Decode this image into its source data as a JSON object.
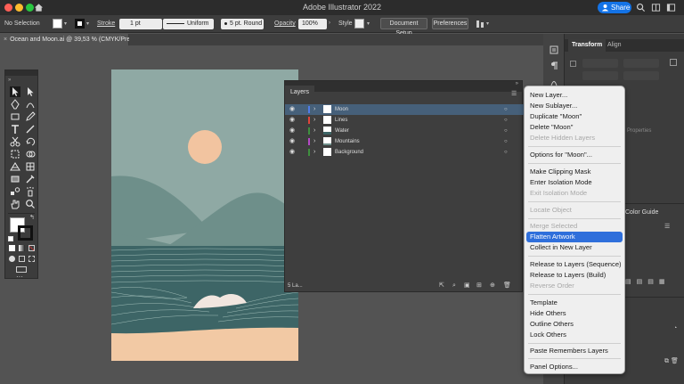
{
  "window": {
    "title": "Adobe Illustrator 2022",
    "share_label": "Share"
  },
  "control_bar": {
    "selection_label": "No Selection",
    "stroke_label": "Stroke",
    "stroke_weight": "1 pt",
    "stroke_profile": "Uniform",
    "brush": "5 pt. Round",
    "opacity_label": "Opacity",
    "opacity_value": "100%",
    "style_label": "Style",
    "document_setup_label": "Document Setup",
    "preferences_label": "Preferences"
  },
  "document_tab": {
    "label": "Ocean and Moon.ai @ 39,53 % (CMYK/Preview)"
  },
  "layers_panel": {
    "title": "Layers",
    "footer_count": "5 La...",
    "layers": [
      {
        "name": "Moon",
        "color": "#4f7be8",
        "selected": true
      },
      {
        "name": "Lines",
        "color": "#e0443a",
        "selected": false
      },
      {
        "name": "Water",
        "color": "#3e8f3e",
        "selected": false
      },
      {
        "name": "Mountains",
        "color": "#3d6fd8",
        "selected": false
      },
      {
        "name": "Background",
        "color": "#b548c6",
        "selected": false
      }
    ]
  },
  "context_menu": {
    "items": [
      {
        "label": "New Layer...",
        "state": "enabled"
      },
      {
        "label": "New Sublayer...",
        "state": "enabled"
      },
      {
        "label": "Duplicate \"Moon\"",
        "state": "enabled"
      },
      {
        "label": "Delete \"Moon\"",
        "state": "enabled"
      },
      {
        "label": "Delete Hidden Layers",
        "state": "disabled"
      },
      {
        "label": "Options for \"Moon\"...",
        "state": "enabled"
      },
      {
        "label": "Make Clipping Mask",
        "state": "enabled"
      },
      {
        "label": "Enter Isolation Mode",
        "state": "enabled"
      },
      {
        "label": "Exit Isolation Mode",
        "state": "disabled"
      },
      {
        "label": "Locate Object",
        "state": "disabled"
      },
      {
        "label": "Merge Selected",
        "state": "disabled"
      },
      {
        "label": "Flatten Artwork",
        "state": "highlighted"
      },
      {
        "label": "Collect in New Layer",
        "state": "enabled"
      },
      {
        "label": "Release to Layers (Sequence)",
        "state": "enabled"
      },
      {
        "label": "Release to Layers (Build)",
        "state": "enabled"
      },
      {
        "label": "Reverse Order",
        "state": "disabled"
      },
      {
        "label": "Template",
        "state": "enabled"
      },
      {
        "label": "Hide Others",
        "state": "enabled"
      },
      {
        "label": "Outline Others",
        "state": "enabled"
      },
      {
        "label": "Lock Others",
        "state": "enabled"
      },
      {
        "label": "Paste Remembers Layers",
        "state": "enabled"
      },
      {
        "label": "Panel Options...",
        "state": "enabled"
      }
    ]
  },
  "right_panel": {
    "tab_transform": "Transform",
    "tab_align": "Align",
    "properties_hint": "Properties",
    "color_guide": "Color Guide"
  },
  "colors": {
    "accent": "#1473e6",
    "menu_highlight": "#2f6fdb",
    "sky": "#8fa9a4",
    "moon": "#f2c4a0",
    "sea": "#3d6566",
    "sand": "#f2c9a4"
  }
}
